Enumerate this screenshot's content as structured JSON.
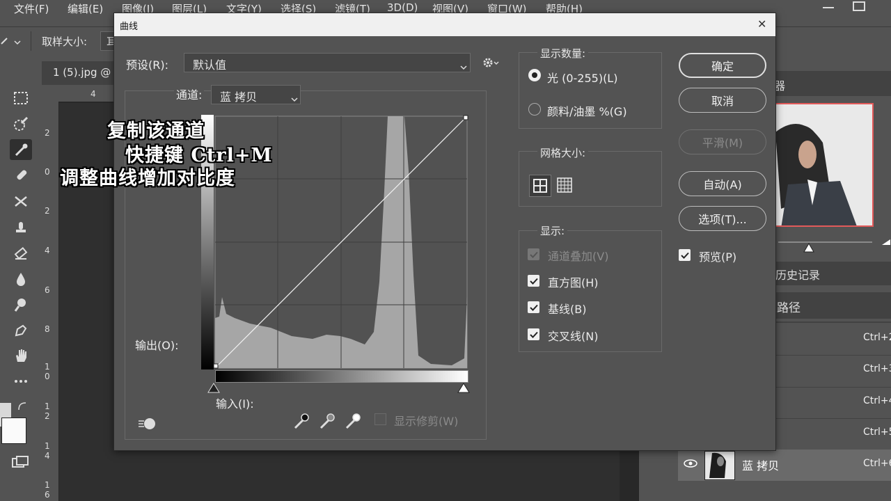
{
  "menubar": {
    "items": [
      "文件(F)",
      "编辑(E)",
      "图像(I)",
      "图层(L)",
      "文字(Y)",
      "选择(S)",
      "滤镜(T)",
      "3D(D)",
      "视图(V)",
      "窗口(W)",
      "帮助(H)"
    ]
  },
  "optionsbar": {
    "sample_size_label": "取样大小:",
    "sample_size_value": "耳"
  },
  "document": {
    "tab_title": "1 (5).jpg @"
  },
  "ruler": {
    "top_tick": "4",
    "left_ticks": [
      "2",
      "0",
      "2",
      "4",
      "6",
      "8",
      "1\n0",
      "1\n2",
      "1\n4",
      "1\n6"
    ]
  },
  "dialog": {
    "title": "曲线",
    "close_glyph": "✕",
    "preset_label": "预设(R):",
    "preset_value": "默认值",
    "channel_label": "通道:",
    "channel_value": "蓝 拷贝",
    "output_label": "输出(O):",
    "input_label": "输入(I):",
    "show_clipping_label": "显示修剪(W)",
    "show_amount": {
      "title": "显示数量:",
      "light_label": "光 (0-255)(L)",
      "pigment_label": "颜料/油墨 %(G)",
      "selected": "light"
    },
    "grid_size": {
      "title": "网格大小:"
    },
    "show": {
      "title": "显示:",
      "channel_overlay": "通道叠加(V)",
      "histogram": "直方图(H)",
      "baseline": "基线(B)",
      "intersection": "交叉线(N)"
    },
    "buttons": {
      "ok": "确定",
      "cancel": "取消",
      "smooth": "平滑(M)",
      "auto": "自动(A)",
      "options": "选项(T)..."
    },
    "preview_label": "预览(P)"
  },
  "overlay_caption": {
    "line1": "复制该通道",
    "line2": "快捷键 Ctrl+M",
    "line3": "调整曲线增加对比度"
  },
  "right_panel": {
    "tab_partial": "器",
    "history_tab": "历史记录",
    "paths_tab": "路径",
    "shortcuts": [
      "Ctrl+2",
      "Ctrl+3",
      "Ctrl+4",
      "Ctrl+5",
      "Ctrl+6"
    ],
    "active_channel": "蓝 拷贝"
  },
  "colors": {
    "ui_bg": "#535353",
    "dialog_title_bg": "#f0f0f0",
    "grid_bg": "#525252",
    "histogram": "#a6a6a6",
    "navigator_border": "#e35a5a"
  }
}
